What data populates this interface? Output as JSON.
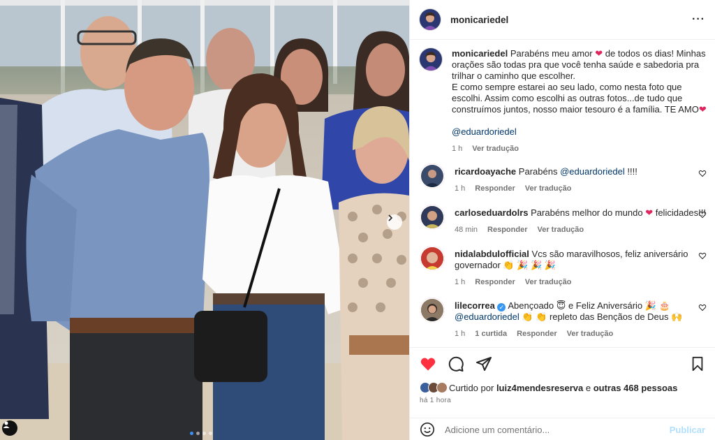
{
  "post": {
    "author": "monicariedel",
    "caption_author": "monicariedel",
    "caption_1": "Parabéns meu amor",
    "caption_2": "de todos os dias! Minhas orações são todas pra que você tenha saúde e sabedoria pra trilhar o caminho que escolher.",
    "caption_3": "E como sempre estarei ao seu lado, como nesta foto que escolhi. Assim como escolhi as outras fotos...de tudo que construímos juntos, nosso maior tesouro é a família. TE AMO",
    "caption_mention": "@eduardoriedel",
    "caption_time": "1 h",
    "translate_label": "Ver tradução"
  },
  "comments": [
    {
      "user": "ricardoayache",
      "text_pre": "Parabéns",
      "mention": "@eduardoriedel",
      "text_post": "!!!!",
      "time": "1 h",
      "reply": "Responder",
      "translate": "Ver tradução"
    },
    {
      "user": "carloseduardolrs",
      "text_pre": "Parabéns melhor do mundo",
      "text_post": "felicidades!!!",
      "time": "48 min",
      "reply": "Responder",
      "translate": "Ver tradução"
    },
    {
      "user": "nidalabdulofficial",
      "text_pre": "Vcs são maravilhosos, feliz aniversário governador",
      "text_post": "",
      "time": "1 h",
      "reply": "Responder",
      "translate": "Ver tradução"
    },
    {
      "user": "lilecorrea",
      "text_pre": "Abençoado",
      "text_mid": "e Feliz Aniversário",
      "mention": "@eduardoriedel",
      "text_post": "repleto das Bençãos de Deus",
      "time": "1 h",
      "likes": "1 curtida",
      "reply": "Responder",
      "translate": "Ver tradução"
    }
  ],
  "likes": {
    "prefix": "Curtido por",
    "user": "luiz4mendesreserva",
    "conj": "e",
    "others": "outras 468 pessoas"
  },
  "posted_ago": "há 1 hora",
  "add_comment": {
    "placeholder": "Adicione um comentário...",
    "publish": "Publicar"
  },
  "icons": {
    "like": "heart-filled-icon",
    "comment": "comment-icon",
    "share": "share-icon",
    "save": "bookmark-icon",
    "more": "more-icon",
    "emoji": "emoji-icon",
    "verified": "verified-icon"
  },
  "colors": {
    "like_red": "#ff3040",
    "link_blue": "#00376b",
    "publish_blue": "#b2dffc",
    "carousel_dot_active": "#3b8ff5"
  },
  "carousel": {
    "count": 4,
    "active": 0
  }
}
